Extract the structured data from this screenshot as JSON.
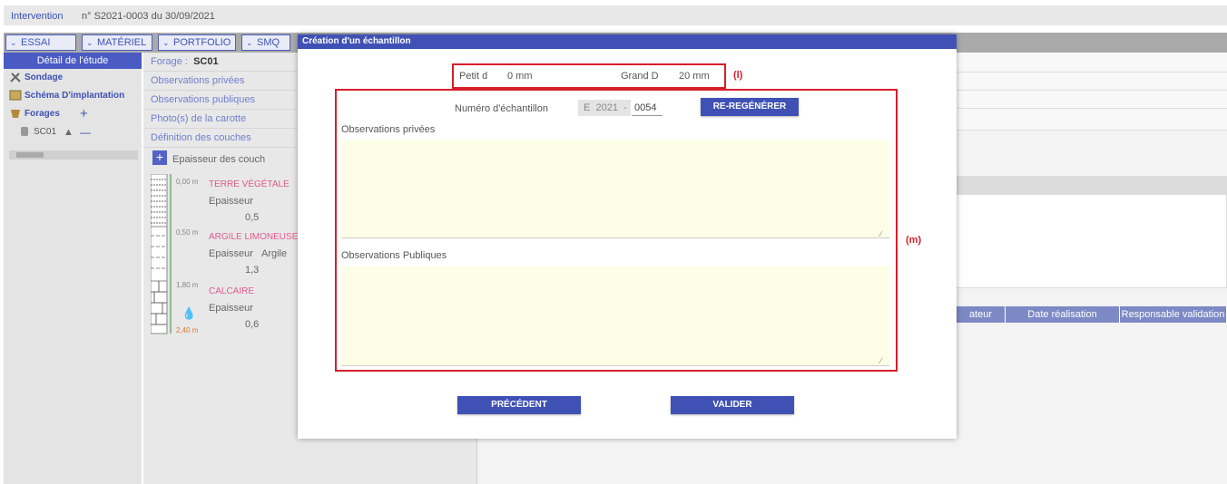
{
  "breadcrumb": {
    "link": "Intervention",
    "text": "n° S2021-0003 du 30/09/2021"
  },
  "menu": [
    "ESSAI",
    "MATÉRIEL",
    "PORTFOLIO",
    "SMQ"
  ],
  "left": {
    "header": "Détail de l'étude",
    "items": [
      "Sondage",
      "Schéma D'implantation",
      "Forages",
      "SC01"
    ]
  },
  "mid": {
    "forage_label": "Forage :",
    "forage_value": "SC01",
    "rows": [
      "Observations privées",
      "Observations publiques",
      "Photo(s) de la carotte",
      "Définition des couches"
    ],
    "epaisseur_couches": "Epaisseur des couch",
    "layers": [
      {
        "depth": "0,00 m",
        "name": "TERRE VÉGÉTALE",
        "label": "Epaisseur",
        "value": "0,5",
        "extra": ""
      },
      {
        "depth": "0,50 m",
        "name": "ARGILE LIMONEUSE",
        "label": "Epaisseur",
        "value": "1,3",
        "extra": "Argile"
      },
      {
        "depth": "1,80 m",
        "name": "CALCAIRE",
        "label": "Epaisseur",
        "value": "0,6",
        "extra": ""
      }
    ],
    "bottom_depth": "2,40 m"
  },
  "table_headers": [
    "ateur",
    "Date réalisation",
    "Responsable validation"
  ],
  "modal": {
    "title": "Création d'un échantillon",
    "petit_d_label": "Petit d",
    "petit_d_value": "0 mm",
    "grand_d_label": "Grand D",
    "grand_d_value": "20 mm",
    "tag_l": "(l)",
    "tag_m": "(m)",
    "numero_label": "Numéro d'échantillon",
    "numero_prefix": "E",
    "numero_year": "2021",
    "numero_sep": "-",
    "numero_value": "0054",
    "regen_button": "RE-REGÉNÉRER",
    "obs_privees_label": "Observations privées",
    "obs_publiques_label": "Observations Publiques",
    "precedent_button": "PRÉCÉDENT",
    "valider_button": "VALIDER"
  },
  "colors": {
    "accent": "#3f51b5",
    "highlight": "#d61e2a",
    "textarea_bg": "#fefee6"
  }
}
